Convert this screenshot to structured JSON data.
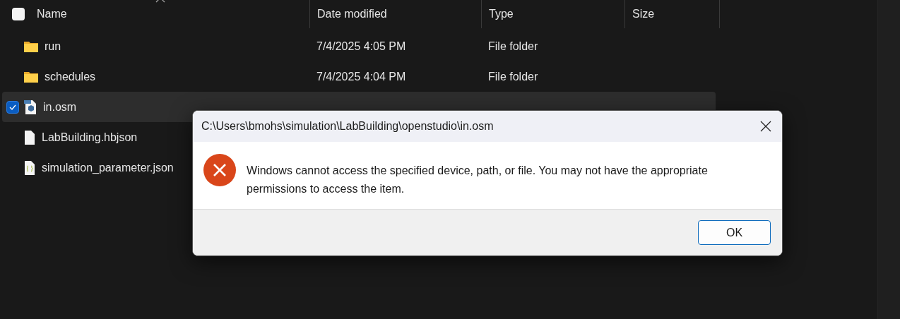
{
  "columns": [
    {
      "label": "Name"
    },
    {
      "label": "Date modified"
    },
    {
      "label": "Type"
    },
    {
      "label": "Size"
    }
  ],
  "select_all": {
    "checked": false
  },
  "rows": [
    {
      "kind": "folder",
      "name": "run",
      "date": "7/4/2025 4:05 PM",
      "type": "File folder",
      "selected": false
    },
    {
      "kind": "folder",
      "name": "schedules",
      "date": "7/4/2025 4:04 PM",
      "type": "File folder",
      "selected": false
    },
    {
      "kind": "model",
      "name": "in.osm",
      "selected": true
    },
    {
      "kind": "file",
      "name": "LabBuilding.hbjson",
      "selected": false
    },
    {
      "kind": "json",
      "name": "simulation_parameter.json",
      "selected": false
    }
  ],
  "dialog": {
    "title": "C:\\Users\\bmohs\\simulation\\LabBuilding\\openstudio\\in.osm",
    "message": "Windows cannot access the specified device, path, or file. You may not have the appropriate permissions to access the item.",
    "buttons": [
      "OK"
    ]
  }
}
